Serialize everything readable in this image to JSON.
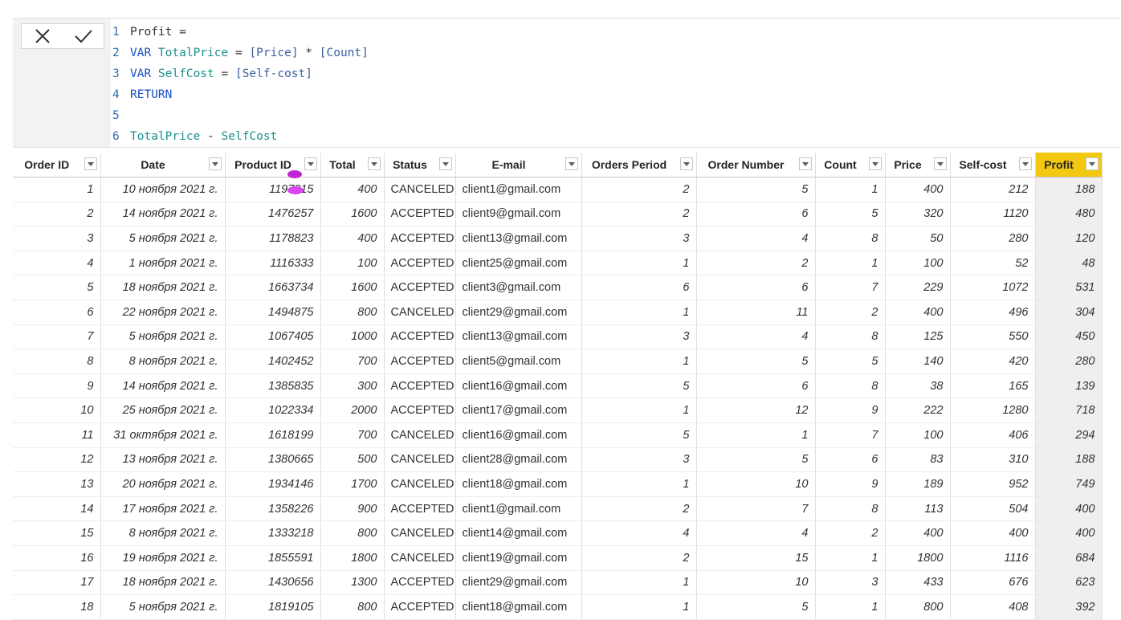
{
  "formula": {
    "lines": [
      {
        "n": "1",
        "parts": [
          [
            "op",
            "Profit ="
          ]
        ]
      },
      {
        "n": "2",
        "parts": [
          [
            "kw",
            "VAR "
          ],
          [
            "var",
            "TotalPrice"
          ],
          [
            "op",
            " = "
          ],
          [
            "ref",
            "[Price]"
          ],
          [
            "op",
            " * "
          ],
          [
            "ref",
            "[Count]"
          ]
        ]
      },
      {
        "n": "3",
        "parts": [
          [
            "kw",
            "VAR "
          ],
          [
            "var",
            "SelfCost"
          ],
          [
            "op",
            " = "
          ],
          [
            "ref",
            "[Self-cost]"
          ]
        ]
      },
      {
        "n": "4",
        "parts": [
          [
            "kw",
            "RETURN"
          ]
        ]
      },
      {
        "n": "5",
        "parts": []
      },
      {
        "n": "6",
        "parts": [
          [
            "var",
            "TotalPrice"
          ],
          [
            "op",
            " - "
          ],
          [
            "var",
            "SelfCost"
          ]
        ]
      }
    ]
  },
  "columns": [
    {
      "label": "Order ID",
      "key": "id",
      "type": "num"
    },
    {
      "label": "Date",
      "key": "date",
      "type": "date"
    },
    {
      "label": "Product ID",
      "key": "pid",
      "type": "num"
    },
    {
      "label": "Total",
      "key": "total",
      "type": "num"
    },
    {
      "label": "Status",
      "key": "status",
      "type": "txt"
    },
    {
      "label": "E-mail",
      "key": "email",
      "type": "txt"
    },
    {
      "label": "Orders Period",
      "key": "period",
      "type": "num"
    },
    {
      "label": "Order Number",
      "key": "onum",
      "type": "num"
    },
    {
      "label": "Count",
      "key": "count",
      "type": "num"
    },
    {
      "label": "Price",
      "key": "price",
      "type": "num"
    },
    {
      "label": "Self-cost",
      "key": "self",
      "type": "num"
    },
    {
      "label": "Profit",
      "key": "profit",
      "type": "num"
    }
  ],
  "rows": [
    {
      "id": "1",
      "date": "10 ноября 2021 г.",
      "pid": "1197815",
      "total": "400",
      "status": "CANCELED",
      "email": "client1@gmail.com",
      "period": "2",
      "onum": "5",
      "count": "1",
      "price": "400",
      "self": "212",
      "profit": "188"
    },
    {
      "id": "2",
      "date": "14 ноября 2021 г.",
      "pid": "1476257",
      "total": "1600",
      "status": "ACCEPTED",
      "email": "client9@gmail.com",
      "period": "2",
      "onum": "6",
      "count": "5",
      "price": "320",
      "self": "1120",
      "profit": "480"
    },
    {
      "id": "3",
      "date": "5 ноября 2021 г.",
      "pid": "1178823",
      "total": "400",
      "status": "ACCEPTED",
      "email": "client13@gmail.com",
      "period": "3",
      "onum": "4",
      "count": "8",
      "price": "50",
      "self": "280",
      "profit": "120"
    },
    {
      "id": "4",
      "date": "1 ноября 2021 г.",
      "pid": "1116333",
      "total": "100",
      "status": "ACCEPTED",
      "email": "client25@gmail.com",
      "period": "1",
      "onum": "2",
      "count": "1",
      "price": "100",
      "self": "52",
      "profit": "48"
    },
    {
      "id": "5",
      "date": "18 ноября 2021 г.",
      "pid": "1663734",
      "total": "1600",
      "status": "ACCEPTED",
      "email": "client3@gmail.com",
      "period": "6",
      "onum": "6",
      "count": "7",
      "price": "229",
      "self": "1072",
      "profit": "531"
    },
    {
      "id": "6",
      "date": "22 ноября 2021 г.",
      "pid": "1494875",
      "total": "800",
      "status": "CANCELED",
      "email": "client29@gmail.com",
      "period": "1",
      "onum": "11",
      "count": "2",
      "price": "400",
      "self": "496",
      "profit": "304"
    },
    {
      "id": "7",
      "date": "5 ноября 2021 г.",
      "pid": "1067405",
      "total": "1000",
      "status": "ACCEPTED",
      "email": "client13@gmail.com",
      "period": "3",
      "onum": "4",
      "count": "8",
      "price": "125",
      "self": "550",
      "profit": "450"
    },
    {
      "id": "8",
      "date": "8 ноября 2021 г.",
      "pid": "1402452",
      "total": "700",
      "status": "ACCEPTED",
      "email": "client5@gmail.com",
      "period": "1",
      "onum": "5",
      "count": "5",
      "price": "140",
      "self": "420",
      "profit": "280"
    },
    {
      "id": "9",
      "date": "14 ноября 2021 г.",
      "pid": "1385835",
      "total": "300",
      "status": "ACCEPTED",
      "email": "client16@gmail.com",
      "period": "5",
      "onum": "6",
      "count": "8",
      "price": "38",
      "self": "165",
      "profit": "139"
    },
    {
      "id": "10",
      "date": "25 ноября 2021 г.",
      "pid": "1022334",
      "total": "2000",
      "status": "ACCEPTED",
      "email": "client17@gmail.com",
      "period": "1",
      "onum": "12",
      "count": "9",
      "price": "222",
      "self": "1280",
      "profit": "718"
    },
    {
      "id": "11",
      "date": "31 октября 2021 г.",
      "pid": "1618199",
      "total": "700",
      "status": "CANCELED",
      "email": "client16@gmail.com",
      "period": "5",
      "onum": "1",
      "count": "7",
      "price": "100",
      "self": "406",
      "profit": "294"
    },
    {
      "id": "12",
      "date": "13 ноября 2021 г.",
      "pid": "1380665",
      "total": "500",
      "status": "CANCELED",
      "email": "client28@gmail.com",
      "period": "3",
      "onum": "5",
      "count": "6",
      "price": "83",
      "self": "310",
      "profit": "188"
    },
    {
      "id": "13",
      "date": "20 ноября 2021 г.",
      "pid": "1934146",
      "total": "1700",
      "status": "CANCELED",
      "email": "client18@gmail.com",
      "period": "1",
      "onum": "10",
      "count": "9",
      "price": "189",
      "self": "952",
      "profit": "749"
    },
    {
      "id": "14",
      "date": "17 ноября 2021 г.",
      "pid": "1358226",
      "total": "900",
      "status": "ACCEPTED",
      "email": "client1@gmail.com",
      "period": "2",
      "onum": "7",
      "count": "8",
      "price": "113",
      "self": "504",
      "profit": "400"
    },
    {
      "id": "15",
      "date": "8 ноября 2021 г.",
      "pid": "1333218",
      "total": "800",
      "status": "CANCELED",
      "email": "client14@gmail.com",
      "period": "4",
      "onum": "4",
      "count": "2",
      "price": "400",
      "self": "400",
      "profit": "400"
    },
    {
      "id": "16",
      "date": "19 ноября 2021 г.",
      "pid": "1855591",
      "total": "1800",
      "status": "CANCELED",
      "email": "client19@gmail.com",
      "period": "2",
      "onum": "15",
      "count": "1",
      "price": "1800",
      "self": "1116",
      "profit": "684"
    },
    {
      "id": "17",
      "date": "18 ноября 2021 г.",
      "pid": "1430656",
      "total": "1300",
      "status": "ACCEPTED",
      "email": "client29@gmail.com",
      "period": "1",
      "onum": "10",
      "count": "3",
      "price": "433",
      "self": "676",
      "profit": "623"
    },
    {
      "id": "18",
      "date": "5 ноября 2021 г.",
      "pid": "1819105",
      "total": "800",
      "status": "ACCEPTED",
      "email": "client18@gmail.com",
      "period": "1",
      "onum": "5",
      "count": "1",
      "price": "800",
      "self": "408",
      "profit": "392"
    }
  ],
  "highlight_column": "Profit",
  "colors": {
    "highlight": "#f2c811",
    "keyword": "#1a4fc4",
    "variable": "#19908a",
    "reference": "#3a5fa0"
  }
}
